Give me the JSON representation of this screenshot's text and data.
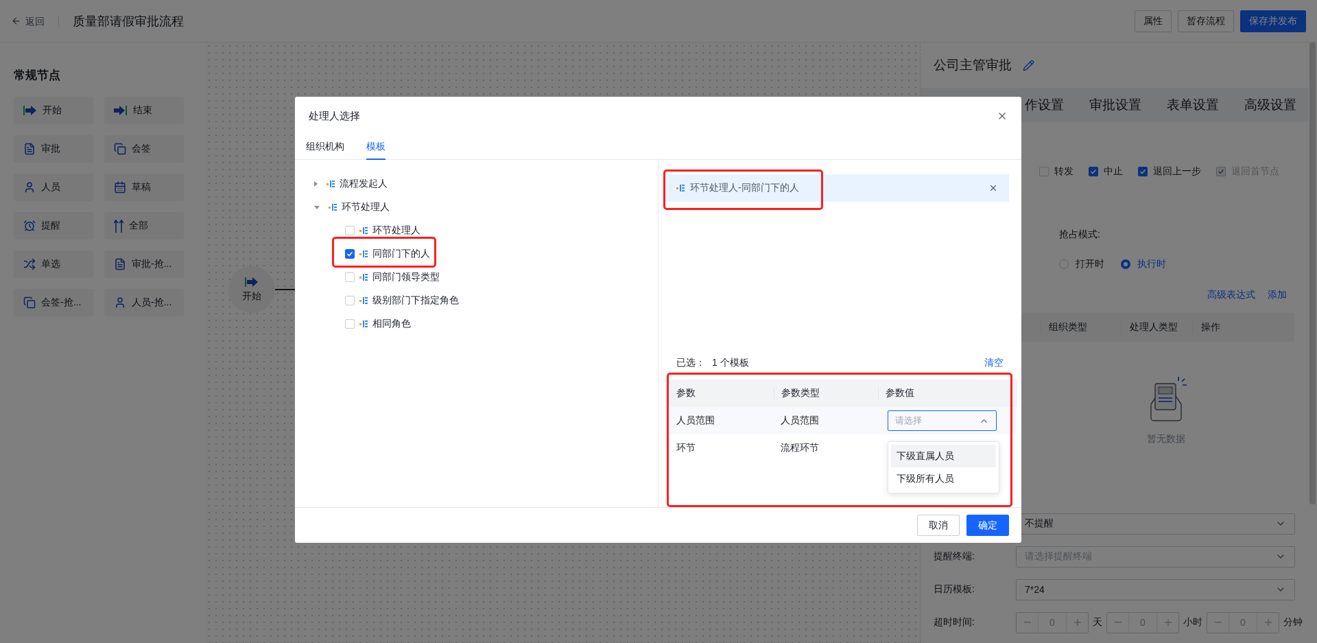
{
  "header": {
    "back": "返回",
    "title": "质量部请假审批流程",
    "buttons": [
      {
        "label": "属性",
        "primary": false
      },
      {
        "label": "暂存流程",
        "primary": false
      },
      {
        "label": "保存并发布",
        "primary": true
      }
    ]
  },
  "palette": {
    "title": "常规节点",
    "nodes": [
      {
        "label": "开始",
        "kind": "start"
      },
      {
        "label": "结束",
        "kind": "end"
      },
      {
        "label": "审批",
        "kind": "approve"
      },
      {
        "label": "会签",
        "kind": "countersign"
      },
      {
        "label": "人员",
        "kind": "person"
      },
      {
        "label": "草稿",
        "kind": "draft"
      },
      {
        "label": "提醒",
        "kind": "remind"
      },
      {
        "label": "全部",
        "kind": "all"
      },
      {
        "label": "单选",
        "kind": "choice"
      },
      {
        "label": "审批-抢...",
        "kind": "approve"
      },
      {
        "label": "会签-抢...",
        "kind": "countersign"
      },
      {
        "label": "人员-抢...",
        "kind": "person"
      }
    ]
  },
  "canvas": {
    "nodes": [
      {
        "label": "开始",
        "kind": "start"
      }
    ]
  },
  "panel": {
    "title": "公司主管审批",
    "tabs": [
      {
        "label": "作设置",
        "selected": false
      },
      {
        "label": "审批设置",
        "selected": false
      },
      {
        "label": "表单设置",
        "selected": false
      },
      {
        "label": "高级设置",
        "selected": false
      }
    ],
    "options": [
      {
        "label": "转发",
        "checked": false,
        "disabled": false
      },
      {
        "label": "中止",
        "checked": true,
        "disabled": false
      },
      {
        "label": "退回上一步",
        "checked": true,
        "disabled": false
      },
      {
        "label": "退回首节点",
        "checked": true,
        "disabled": true
      }
    ],
    "grab_mode": {
      "label": "抢占模式:",
      "options": [
        {
          "label": "打开时",
          "selected": false
        },
        {
          "label": "执行时",
          "selected": true
        }
      ]
    },
    "links": [
      "高级表达式",
      "添加"
    ],
    "table": {
      "columns": [
        "组织类型",
        "处理人类型",
        "操作"
      ],
      "empty": "暂无数据"
    },
    "form": [
      {
        "kind": "select",
        "value": "不提醒"
      },
      {
        "kind": "select",
        "label": "提醒终端:",
        "placeholder": "请选择提醒终端"
      },
      {
        "kind": "select",
        "label": "日历模板:",
        "value": "7*24"
      },
      {
        "kind": "duration",
        "label": "超时时间:",
        "spins": [
          {
            "value": "0",
            "unit": "天"
          },
          {
            "value": "0",
            "unit": "小时"
          },
          {
            "value": "0",
            "unit": "分钟"
          }
        ]
      }
    ]
  },
  "dialog": {
    "title": "处理人选择",
    "tabs": [
      {
        "label": "组织机构",
        "selected": false
      },
      {
        "label": "模板",
        "selected": true
      }
    ],
    "tree": [
      {
        "label": "流程发起人",
        "expanded": false
      },
      {
        "label": "环节处理人",
        "expanded": true,
        "children": [
          {
            "label": "环节处理人",
            "checked": false
          },
          {
            "label": "同部门下的人",
            "checked": true
          },
          {
            "label": "同部门领导类型",
            "checked": false
          },
          {
            "label": "级别部门下指定角色",
            "checked": false
          },
          {
            "label": "相同角色",
            "checked": false
          }
        ]
      }
    ],
    "chosen": [
      {
        "label": "环节处理人-同部门下的人"
      }
    ],
    "summary": {
      "label": "已选：",
      "count": "1 个模板",
      "clear": "清空"
    },
    "params": {
      "columns": [
        "参数",
        "参数类型",
        "参数值"
      ],
      "rows": [
        {
          "name": "人员范围",
          "type": "人员范围",
          "select": {
            "placeholder": "请选择",
            "open": true,
            "options": [
              {
                "label": "下级直属人员",
                "highlighted": true
              },
              {
                "label": "下级所有人员",
                "highlighted": false
              }
            ]
          }
        },
        {
          "name": "环节",
          "type": "流程环节"
        }
      ]
    },
    "buttons": [
      {
        "label": "取消",
        "primary": false
      },
      {
        "label": "确定",
        "primary": true
      }
    ]
  }
}
